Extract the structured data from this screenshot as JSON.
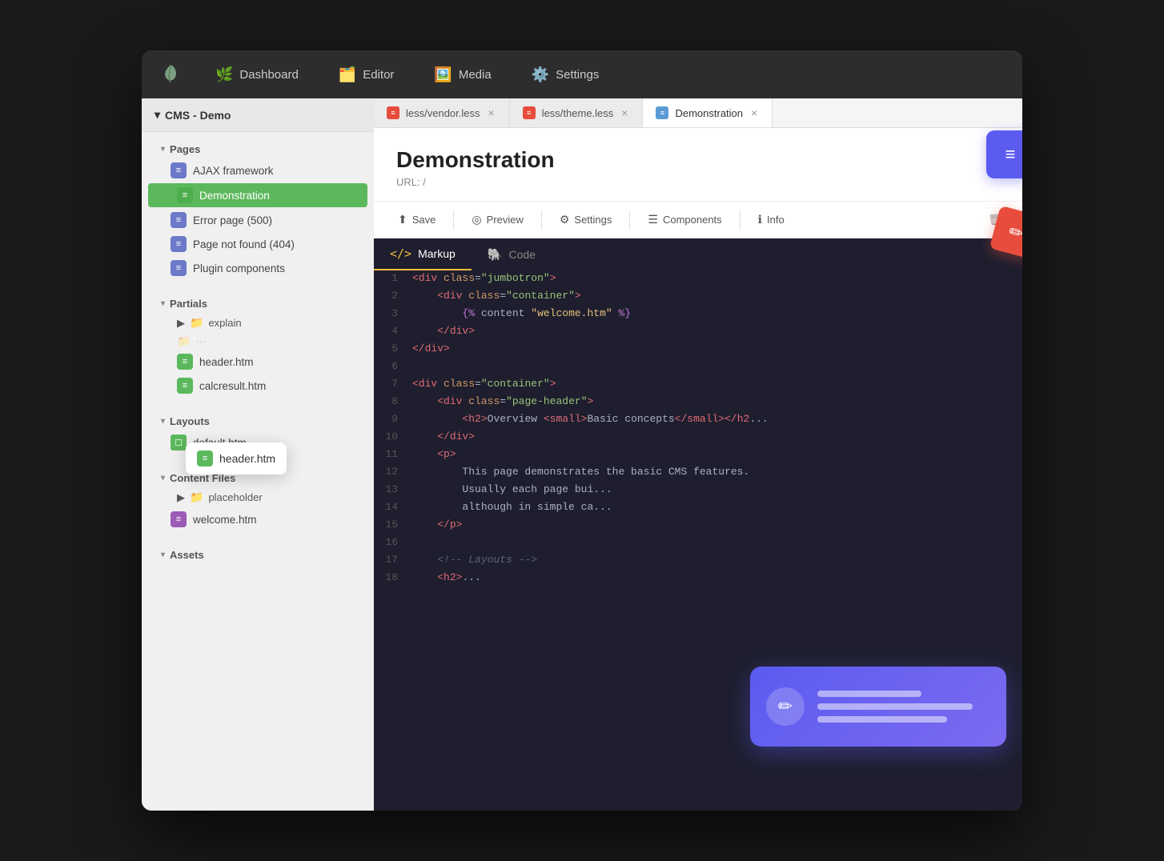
{
  "nav": {
    "logo_label": "🌿",
    "items": [
      {
        "id": "dashboard",
        "label": "Dashboard",
        "icon": "🌿"
      },
      {
        "id": "editor",
        "label": "Editor",
        "icon": "🗂️"
      },
      {
        "id": "media",
        "label": "Media",
        "icon": "🖼️"
      },
      {
        "id": "settings",
        "label": "Settings",
        "icon": "⚙️"
      }
    ]
  },
  "sidebar": {
    "root_label": "CMS - Demo",
    "groups": [
      {
        "id": "pages",
        "label": "Pages",
        "expanded": true,
        "items": [
          {
            "id": "ajax",
            "label": "AJAX framework",
            "icon_type": "page",
            "active": false
          },
          {
            "id": "demonstration",
            "label": "Demonstration",
            "icon_type": "page",
            "active": true
          },
          {
            "id": "error",
            "label": "Error page (500)",
            "icon_type": "page",
            "active": false
          },
          {
            "id": "notfound",
            "label": "Page not found (404)",
            "icon_type": "page",
            "active": false
          },
          {
            "id": "plugin",
            "label": "Plugin components",
            "icon_type": "page",
            "active": false
          }
        ]
      },
      {
        "id": "partials",
        "label": "Partials",
        "expanded": true,
        "sub_groups": [
          {
            "id": "explain",
            "label": "explain"
          }
        ],
        "items": [
          {
            "id": "header_htm",
            "label": "header.htm",
            "icon_type": "partial_green"
          },
          {
            "id": "calcresult",
            "label": "calcresult.htm",
            "icon_type": "partial_green"
          }
        ]
      },
      {
        "id": "layouts",
        "label": "Layouts",
        "expanded": true,
        "items": [
          {
            "id": "default",
            "label": "default.htm",
            "icon_type": "layout"
          }
        ]
      },
      {
        "id": "content",
        "label": "Content Files",
        "expanded": true,
        "sub_groups": [
          {
            "id": "placeholder",
            "label": "placeholder"
          }
        ],
        "items": [
          {
            "id": "welcome",
            "label": "welcome.htm",
            "icon_type": "content_purple"
          }
        ]
      },
      {
        "id": "assets",
        "label": "Assets",
        "expanded": false,
        "items": []
      }
    ]
  },
  "tooltip": {
    "label": "header.htm",
    "icon_type": "partial_green"
  },
  "tabs": [
    {
      "id": "vendor",
      "label": "less/vendor.less",
      "icon_type": "red",
      "active": false
    },
    {
      "id": "theme",
      "label": "less/theme.less",
      "icon_type": "red",
      "active": false
    },
    {
      "id": "demonstration",
      "label": "Demonstration",
      "icon_type": "blue",
      "active": true
    }
  ],
  "page": {
    "title": "Demonstration",
    "url_label": "URL:",
    "url_value": "/"
  },
  "actions": [
    {
      "id": "save",
      "label": "Save",
      "icon": "⬆"
    },
    {
      "id": "preview",
      "label": "Preview",
      "icon": "◎"
    },
    {
      "id": "settings",
      "label": "Settings",
      "icon": "⚙"
    },
    {
      "id": "components",
      "label": "Components",
      "icon": "☰"
    },
    {
      "id": "info",
      "label": "Info",
      "icon": "ℹ"
    }
  ],
  "code_tabs": [
    {
      "id": "markup",
      "label": "Markup",
      "icon": "<>",
      "active": true
    },
    {
      "id": "code",
      "label": "Code",
      "icon": "🐘",
      "active": false
    }
  ],
  "code_lines": [
    {
      "num": 1,
      "content": "<div class=\"jumbotron\">"
    },
    {
      "num": 2,
      "content": "    <div class=\"container\">"
    },
    {
      "num": 3,
      "content": "        {% content \"welcome.htm\" %}"
    },
    {
      "num": 4,
      "content": "    </div>"
    },
    {
      "num": 5,
      "content": "</div>"
    },
    {
      "num": 6,
      "content": ""
    },
    {
      "num": 7,
      "content": "<div class=\"container\">"
    },
    {
      "num": 8,
      "content": "    <div class=\"page-header\">"
    },
    {
      "num": 9,
      "content": "        <h2>Overview <small>Basic concepts</small></h2>"
    },
    {
      "num": 10,
      "content": "    </div>"
    },
    {
      "num": 11,
      "content": "    <p>"
    },
    {
      "num": 12,
      "content": "        This page demonstrates the basic CMS features."
    },
    {
      "num": 13,
      "content": "        Usually each page bui..."
    },
    {
      "num": 14,
      "content": "        although in simple ca..."
    },
    {
      "num": 15,
      "content": "    </p>"
    },
    {
      "num": 16,
      "content": ""
    },
    {
      "num": 17,
      "content": "    <!-- Layouts -->"
    },
    {
      "num": 18,
      "content": "    <h2>..."
    }
  ]
}
